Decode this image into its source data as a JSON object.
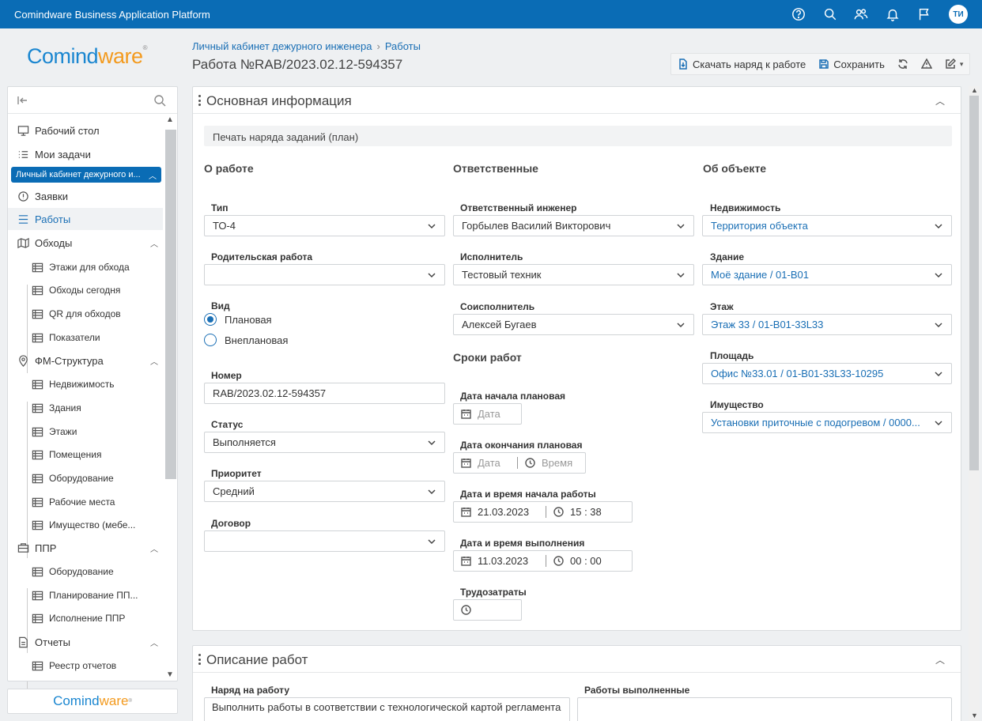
{
  "app": {
    "title": "Comindware Business Application Platform",
    "user_initials": "ТИ"
  },
  "topbar_icons": [
    "help-icon",
    "search-icon",
    "people-icon",
    "bell-icon",
    "flag-icon"
  ],
  "logo": {
    "main": "Comind",
    "accent": "ware",
    "mark": "®"
  },
  "breadcrumb": {
    "items": [
      "Личный кабинет дежурного инженера",
      "Работы"
    ]
  },
  "page": {
    "title": "Работа №RAB/2023.02.12-594357"
  },
  "toolbar": {
    "download_label": "Скачать наряд к работе",
    "save_label": "Сохранить"
  },
  "sidebar": {
    "items": [
      {
        "label": "Рабочий стол",
        "icon": "desktop-icon"
      },
      {
        "label": "Мои задачи",
        "icon": "tasks-icon"
      },
      {
        "label": "Личный кабинет дежурного и...",
        "icon": ""
      },
      {
        "label": "Заявки",
        "icon": "alert-icon"
      },
      {
        "label": "Работы",
        "icon": "list-icon"
      },
      {
        "label": "Обходы",
        "icon": "map-icon"
      },
      {
        "label": "Этажи для обхода",
        "icon": "table-icon"
      },
      {
        "label": "Обходы сегодня",
        "icon": "table-icon"
      },
      {
        "label": "QR для обходов",
        "icon": "table-icon"
      },
      {
        "label": "Показатели",
        "icon": "table-icon"
      },
      {
        "label": "ФМ-Структура",
        "icon": "pin-icon"
      },
      {
        "label": "Недвижимость",
        "icon": "table-icon"
      },
      {
        "label": "Здания",
        "icon": "table-icon"
      },
      {
        "label": "Этажи",
        "icon": "table-icon"
      },
      {
        "label": "Помещения",
        "icon": "table-icon"
      },
      {
        "label": "Оборудование",
        "icon": "table-icon"
      },
      {
        "label": "Рабочие места",
        "icon": "table-icon"
      },
      {
        "label": "Имущество (мебе...",
        "icon": "table-icon"
      },
      {
        "label": "ППР",
        "icon": "ppr-icon"
      },
      {
        "label": "Оборудование",
        "icon": "table-icon"
      },
      {
        "label": "Планирование ПП...",
        "icon": "table-icon"
      },
      {
        "label": "Исполнение ППР",
        "icon": "table-icon"
      },
      {
        "label": "Отчеты",
        "icon": "report-icon"
      },
      {
        "label": "Реестр отчетов",
        "icon": "table-icon"
      }
    ]
  },
  "main_panel": {
    "title": "Основная информация",
    "print_label": "Печать наряда заданий (план)",
    "sections": {
      "about": "О работе",
      "responsible": "Ответственные",
      "object": "Об объекте",
      "deadlines": "Сроки работ"
    },
    "fields": {
      "type": {
        "label": "Тип",
        "value": "ТО-4"
      },
      "parent": {
        "label": "Родительская работа",
        "value": ""
      },
      "kind": {
        "label": "Вид",
        "options": [
          "Плановая",
          "Внеплановая"
        ],
        "selected": "Плановая"
      },
      "number": {
        "label": "Номер",
        "value": "RAB/2023.02.12-594357"
      },
      "status": {
        "label": "Статус",
        "value": "Выполняется"
      },
      "priority": {
        "label": "Приоритет",
        "value": "Средний"
      },
      "contract": {
        "label": "Договор",
        "value": ""
      },
      "engineer": {
        "label": "Ответственный инженер",
        "value": "Горбылев Василий Викторович"
      },
      "executor": {
        "label": "Исполнитель",
        "value": "Тестовый техник"
      },
      "coexecutor": {
        "label": "Соисполнитель",
        "value": "Алексей Бугаев"
      },
      "start_plan": {
        "label": "Дата начала плановая",
        "date_placeholder": "Дата"
      },
      "end_plan": {
        "label": "Дата окончания плановая",
        "date_placeholder": "Дата",
        "time_placeholder": "Время"
      },
      "start_work": {
        "label": "Дата и время начала работы",
        "date": "21.03.2023",
        "time": "15 : 38"
      },
      "done": {
        "label": "Дата и время выполнения",
        "date": "11.03.2023",
        "time": "00 : 00"
      },
      "labor": {
        "label": "Трудозатраты",
        "value": ""
      },
      "property": {
        "label": "Недвижимость",
        "value": "Территория объекта"
      },
      "building": {
        "label": "Здание",
        "value": "Моё здание / 01-В01"
      },
      "floor": {
        "label": "Этаж",
        "value": "Этаж 33 / 01-В01-33L33"
      },
      "area": {
        "label": "Площадь",
        "value": "Офис №33.01 / 01-В01-33L33-10295"
      },
      "asset": {
        "label": "Имущество",
        "value": "Установки приточные с подогревом / 0000..."
      }
    }
  },
  "desc_panel": {
    "title": "Описание работ",
    "order_label": "Наряд на работу",
    "order_value": "Выполнить работы в соответствии с технологической картой регламента",
    "done_label": "Работы выполненные",
    "done_value": ""
  },
  "colors": {
    "accent": "#0a6cb5",
    "link": "#1a6fb5"
  }
}
